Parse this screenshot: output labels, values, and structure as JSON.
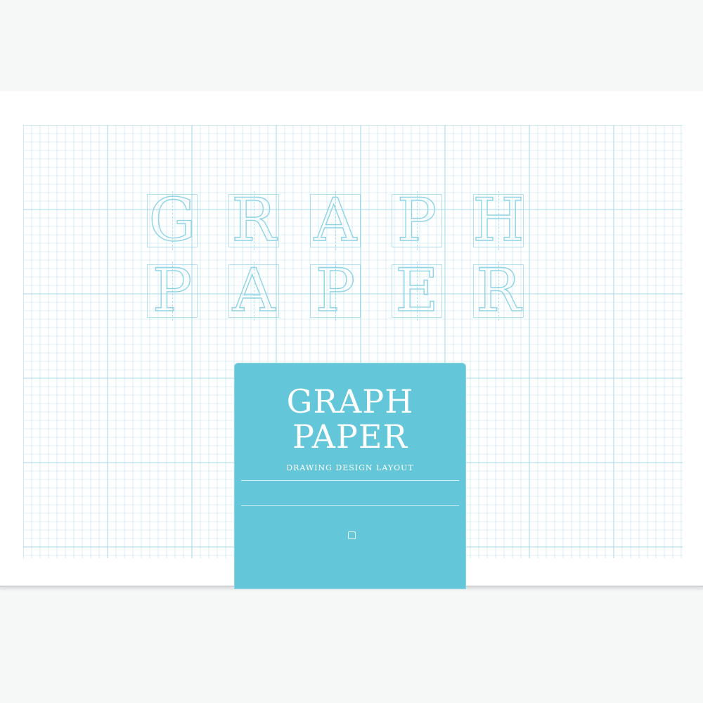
{
  "product": {
    "title_line1": "GRAPH",
    "title_line2": "PAPER",
    "subtitle": "DRAWING  DESIGN  LAYOUT"
  },
  "decorative_letters": {
    "row1": [
      "G",
      "R",
      "A",
      "P",
      "H"
    ],
    "row2": [
      "P",
      "A",
      "P",
      "E",
      "R"
    ]
  },
  "colors": {
    "label": "#63c6d9",
    "grid_line": "#bfe3ee",
    "grid_major": "#a9d8e8",
    "letter_outline": "#8fd4e6",
    "pad": "#ffffff"
  }
}
